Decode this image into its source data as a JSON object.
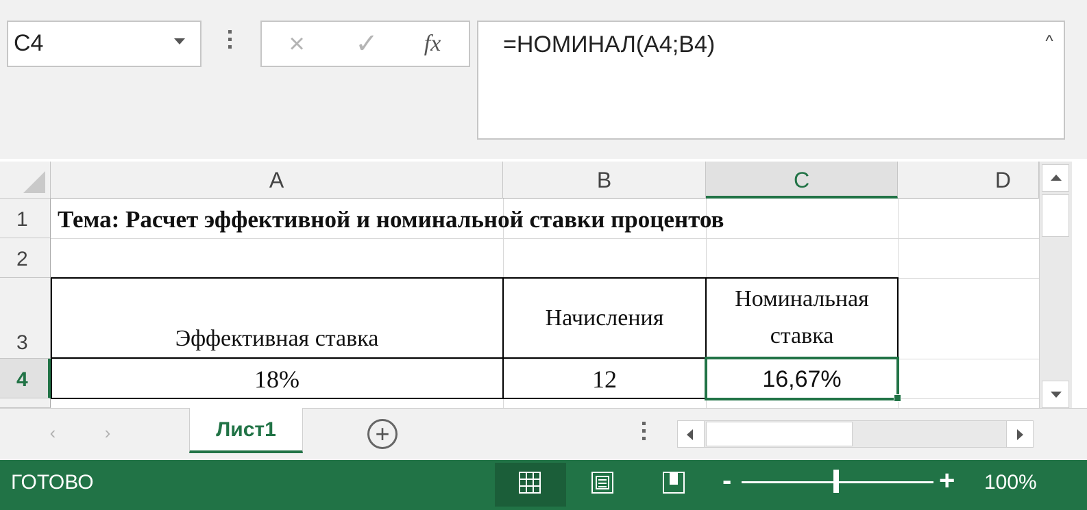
{
  "formula_bar": {
    "name_box": "C4",
    "formula": "=НОМИНАЛ(A4;B4)",
    "cancel_icon": "×",
    "enter_icon": "✓",
    "fx_label": "fx",
    "collapse_icon": "^"
  },
  "columns": [
    "A",
    "B",
    "C",
    "D"
  ],
  "active_column": "C",
  "rows": [
    "1",
    "2",
    "3",
    "4"
  ],
  "active_row": "4",
  "cells": {
    "A1": "Тема: Расчет эффективной и номинальной ставки процентов",
    "A3": "Эффективная ставка",
    "B3": "Начисления",
    "C3_line1": "Номинальная",
    "C3_line2": "ставка",
    "A4": "18%",
    "B4": "12",
    "C4": "16,67%"
  },
  "sheet_tabs": {
    "active": "Лист1",
    "add_icon": "+"
  },
  "status_bar": {
    "status": "ГОТОВО",
    "zoom": "100%",
    "zoom_minus": "-",
    "zoom_plus": "+"
  },
  "colors": {
    "accent": "#217346",
    "header_bg": "#f1f1f1"
  }
}
